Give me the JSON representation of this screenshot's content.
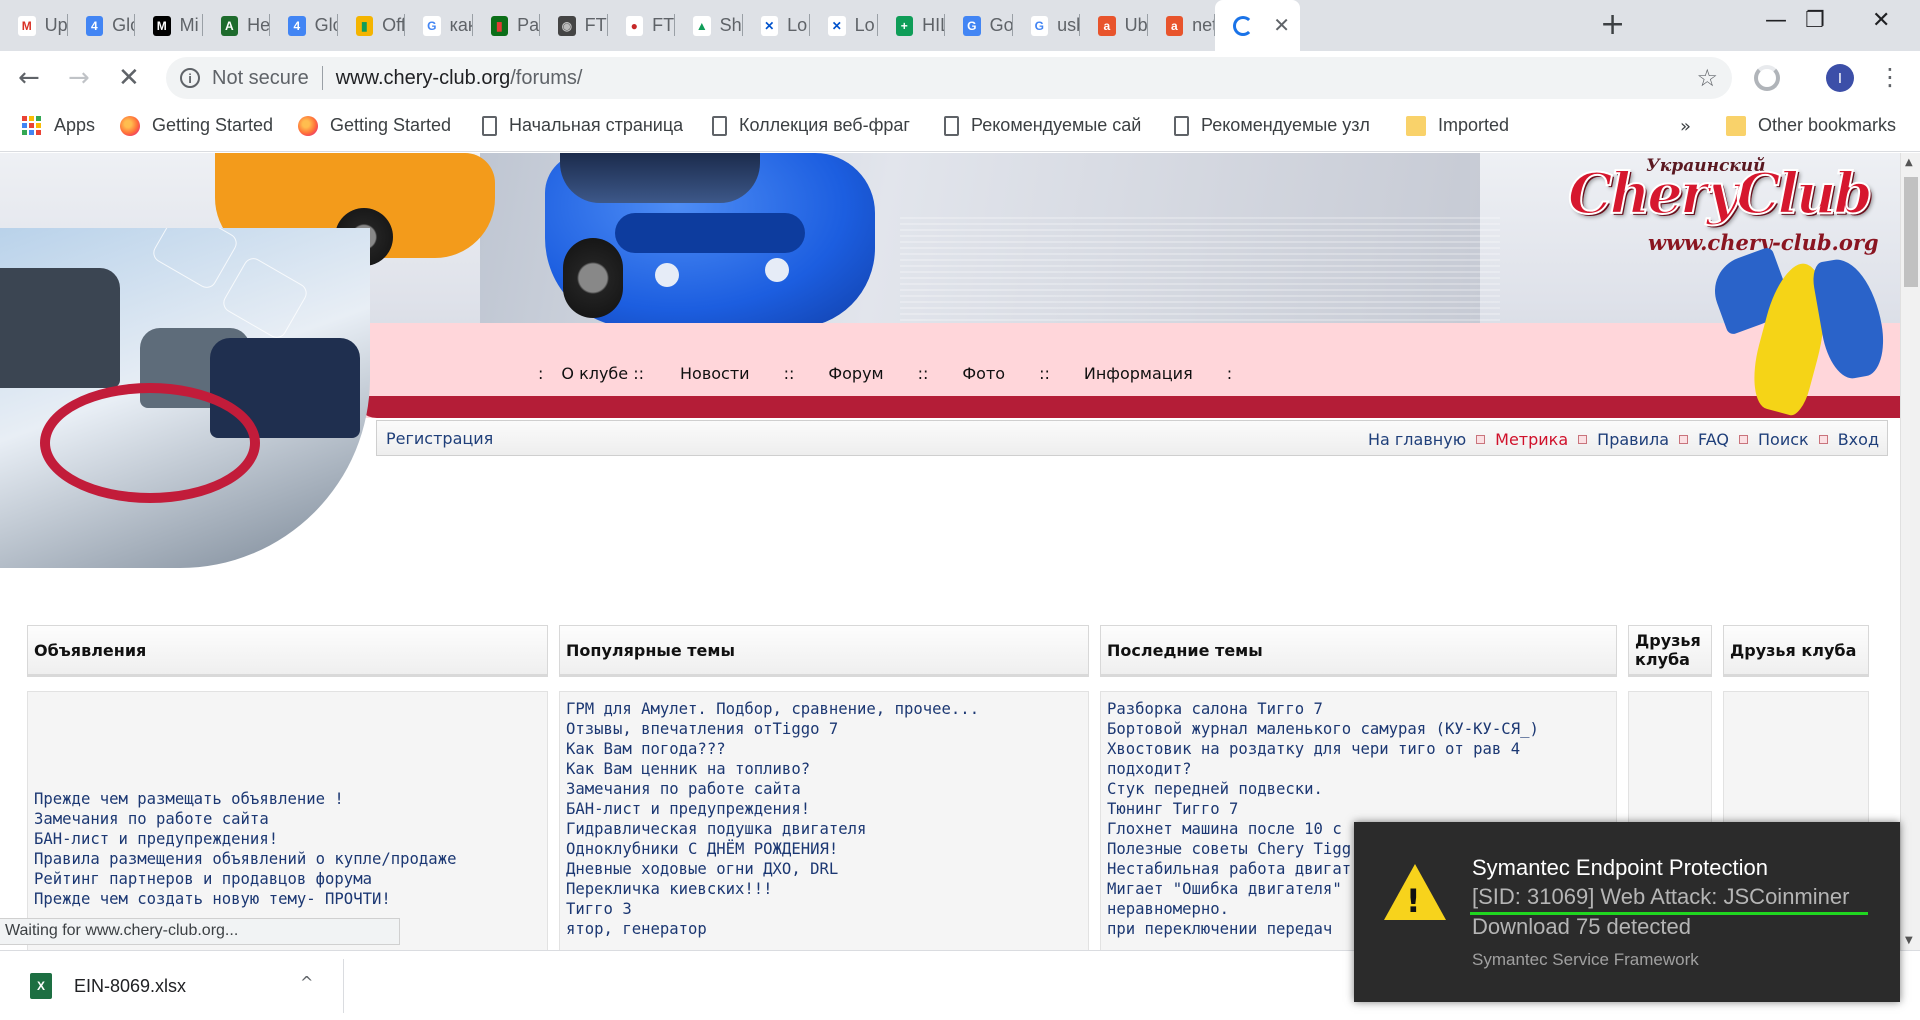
{
  "tabs": [
    {
      "title": "Up",
      "icon": "gmail-icon",
      "color": "#ffffff",
      "glyph": "M",
      "glyph_color": "#d93025"
    },
    {
      "title": "Glo",
      "icon": "calendar-icon",
      "color": "#4285f4",
      "glyph": "4",
      "glyph_color": "#ffffff"
    },
    {
      "title": "Mi",
      "icon": "medium-icon",
      "color": "#000000",
      "glyph": "M",
      "glyph_color": "#ffffff"
    },
    {
      "title": "He",
      "icon": "android-icon",
      "color": "#1e6b2d",
      "glyph": "A",
      "glyph_color": "#ffffff"
    },
    {
      "title": "Glo",
      "icon": "calendar-icon",
      "color": "#4285f4",
      "glyph": "4",
      "glyph_color": "#ffffff"
    },
    {
      "title": "Off",
      "icon": "chart-icon",
      "color": "#f4b400",
      "glyph": "▮",
      "glyph_color": "#0f9d58"
    },
    {
      "title": "как",
      "icon": "google-icon",
      "color": "#ffffff",
      "glyph": "G",
      "glyph_color": "#4285f4"
    },
    {
      "title": "Pat",
      "icon": "stock-chart-icon",
      "color": "#0b6e18",
      "glyph": "▮",
      "glyph_color": "#e53935"
    },
    {
      "title": "FTS",
      "icon": "camera-icon",
      "color": "#444444",
      "glyph": "◉",
      "glyph_color": "#bbbbbb"
    },
    {
      "title": "FTI",
      "icon": "record-icon",
      "color": "#ffffff",
      "glyph": "●",
      "glyph_color": "#c62828"
    },
    {
      "title": "Sha",
      "icon": "drive-icon",
      "color": "#ffffff",
      "glyph": "▲",
      "glyph_color": "#0f9d58"
    },
    {
      "title": "Lo",
      "icon": "confluence-icon",
      "color": "#ffffff",
      "glyph": "✕",
      "glyph_color": "#0052cc"
    },
    {
      "title": "Lo",
      "icon": "confluence-icon",
      "color": "#ffffff",
      "glyph": "✕",
      "glyph_color": "#0052cc"
    },
    {
      "title": "HIL",
      "icon": "sheets-icon",
      "color": "#0f9d58",
      "glyph": "+",
      "glyph_color": "#ffffff"
    },
    {
      "title": "Go",
      "icon": "translate-icon",
      "color": "#4285f4",
      "glyph": "G",
      "glyph_color": "#ffffff"
    },
    {
      "title": "usb",
      "icon": "google-icon",
      "color": "#ffffff",
      "glyph": "G",
      "glyph_color": "#4285f4"
    },
    {
      "title": "Ub",
      "icon": "ask-icon",
      "color": "#e8542c",
      "glyph": "a",
      "glyph_color": "#ffffff"
    },
    {
      "title": "net",
      "icon": "ask-icon",
      "color": "#e8542c",
      "glyph": "a",
      "glyph_color": "#ffffff"
    }
  ],
  "active_tab": {
    "title": "",
    "icon": "loading-spinner-icon"
  },
  "window": {
    "new_tab": "+",
    "minimize": "—",
    "restore": "❐",
    "close": "✕"
  },
  "toolbar": {
    "back": "←",
    "forward": "→",
    "stop": "✕",
    "security_label": "Not secure",
    "url_host": "www.chery-club.org",
    "url_path": "/forums/",
    "star": "☆",
    "menu": "⋮",
    "profile_initial": "I"
  },
  "bookmarks": [
    {
      "label": "Apps",
      "icon": "apps-grid-icon"
    },
    {
      "label": "Getting Started",
      "icon": "firefox-icon"
    },
    {
      "label": "Getting Started",
      "icon": "firefox-icon"
    },
    {
      "label": "Начальная страница",
      "icon": "page-icon"
    },
    {
      "label": "Коллекция веб-фраг",
      "icon": "page-icon"
    },
    {
      "label": "Рекомендуемые сай",
      "icon": "page-icon"
    },
    {
      "label": "Рекомендуемые узл",
      "icon": "page-icon"
    },
    {
      "label": "Imported",
      "icon": "folder-icon"
    }
  ],
  "bookmarks_more": "»",
  "other_bookmarks": "Other bookmarks",
  "site": {
    "logo_sub": "Украинский",
    "logo_main": "CheryClub",
    "logo_url": "www.chery-club.org",
    "top_nav": [
      "О клубе ::",
      "Новости",
      "Форум",
      "Фото",
      "Информация"
    ],
    "sub_nav_left": "Регистрация",
    "sub_nav_right": [
      {
        "label": "На главную",
        "accent": false
      },
      {
        "label": "Метрика",
        "accent": true
      },
      {
        "label": "Правила",
        "accent": false
      },
      {
        "label": "FAQ",
        "accent": false
      },
      {
        "label": "Поиск",
        "accent": false
      },
      {
        "label": "Вход",
        "accent": false
      }
    ],
    "columns": [
      {
        "title": "Объявления"
      },
      {
        "title": "Популярные темы"
      },
      {
        "title": "Последние темы"
      },
      {
        "title": "Друзья клуба"
      },
      {
        "title": "Друзья клуба"
      }
    ],
    "announcements": [
      "Прежде чем размещать объявление !",
      "Замечания по работе сайта",
      "БАН-лист и предупреждения!",
      "Правила размещения объявлений о купле/продаже",
      "Рейтинг партнеров и продавцов форума",
      "Прежде чем создать новую тему- ПРОЧТИ!"
    ],
    "popular": [
      "ГРМ для Амулет. Подбор, сравнение, прочее...",
      "Отзывы, впечатления отTiggo 7",
      "Как Вам погода???",
      "Как Вам ценник на топливо?",
      "Замечания по работе сайта",
      "БАН-лист и предупреждения!",
      "Гидравлическая подушка двигателя",
      "Одноклубники С ДНЁМ РОЖДЕНИЯ!",
      "Дневные ходовые огни ДХО, DRL",
      "Перекличка киевских!!!",
      "Тигго 3",
      "   ятор, генератор"
    ],
    "recent": [
      "Разборка салона Тигго 7",
      "Бортовой журнал маленького самурая (КУ-КУ-СЯ_)",
      "Хвостовик на роздатку для чери тиго от рав 4",
      "подходит?",
      "Стук передней подвески.",
      "Тюнинг Тигго 7",
      "Глохнет машина после 10 с",
      "Полезные советы Chery Tigg",
      "Нестабильная работа двигат",
      "Мигает \"Ошибка двигателя\"",
      "неравномерно.",
      "при переключении передач"
    ]
  },
  "status_text": "Waiting for www.chery-club.org...",
  "download": {
    "filename": "EIN-8069.xlsx",
    "icon_glyph": "X",
    "chevron": "^"
  },
  "toast": {
    "title": "Symantec Endpoint Protection",
    "line1": "[SID: 31069] Web Attack: JSCoinminer",
    "line2": "Download 75 detected",
    "source": "Symantec Service Framework",
    "warning_glyph": "!"
  }
}
